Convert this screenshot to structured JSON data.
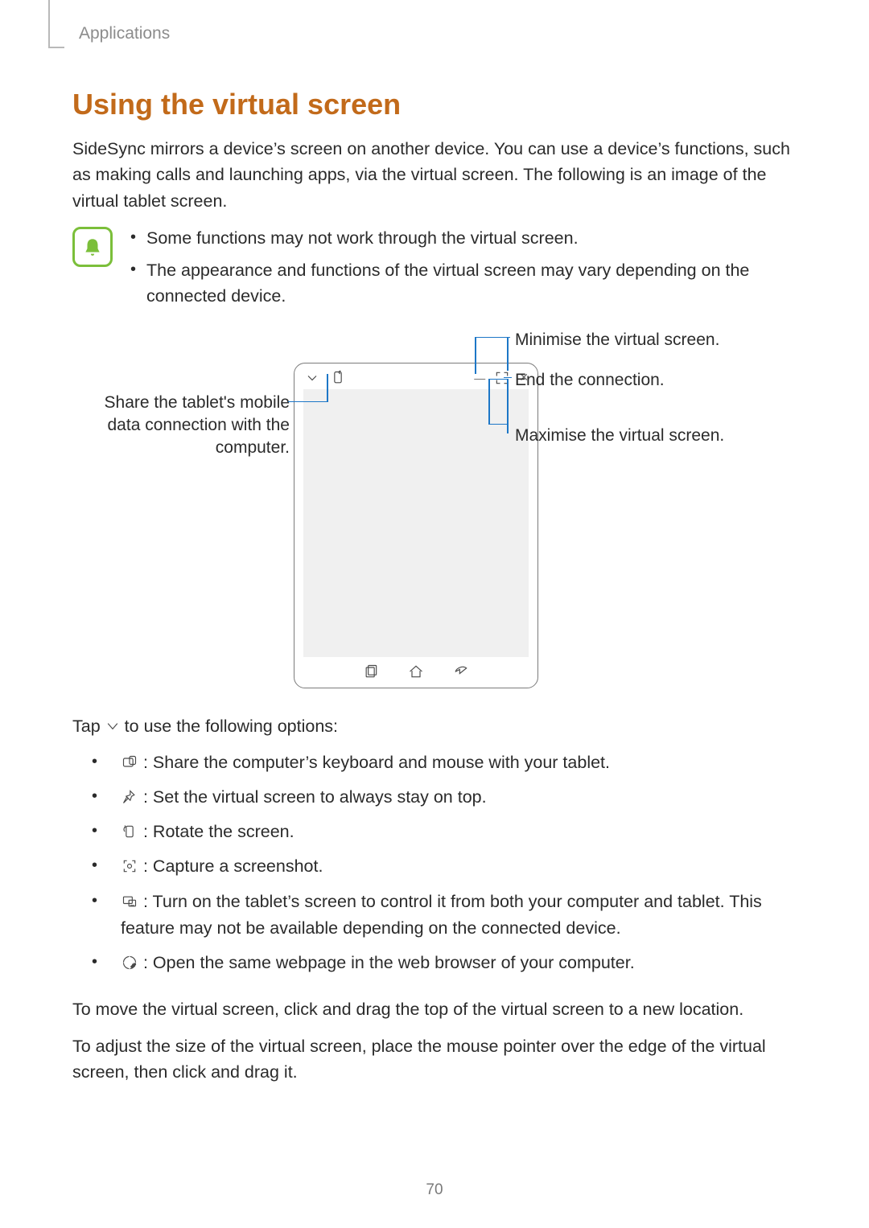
{
  "section_label": "Applications",
  "title": "Using the virtual screen",
  "intro": "SideSync mirrors a device’s screen on another device. You can use a device’s functions, such as making calls and launching apps, via the virtual screen. The following is an image of the virtual tablet screen.",
  "notes": {
    "item1": "Some functions may not work through the virtual screen.",
    "item2": "The appearance and functions of the virtual screen may vary depending on the connected device."
  },
  "callouts": {
    "minimise": "Minimise the virtual screen.",
    "end": "End the connection.",
    "maximise": "Maximise the virtual screen.",
    "share": "Share the tablet's mobile data connection with the computer."
  },
  "tap_prefix": "Tap ",
  "tap_suffix": " to use the following options:",
  "options": {
    "o1": " : Share the computer’s keyboard and mouse with your tablet.",
    "o2": " : Set the virtual screen to always stay on top.",
    "o3": " : Rotate the screen.",
    "o4": " : Capture a screenshot.",
    "o5": " : Turn on the tablet’s screen to control it from both your computer and tablet. This feature may not be available depending on the connected device.",
    "o6": " : Open the same webpage in the web browser of your computer."
  },
  "move_para": "To move the virtual screen, click and drag the top of the virtual screen to a new location.",
  "resize_para": "To adjust the size of the virtual screen, place the mouse pointer over the edge of the virtual screen, then click and drag it.",
  "page_number": "70"
}
